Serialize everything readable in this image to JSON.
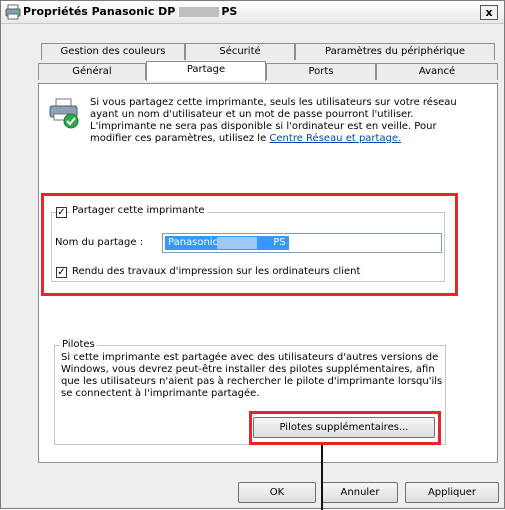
{
  "window": {
    "title_left": "Propriétés Panasonic DP",
    "title_right": "PS",
    "close_label": "x"
  },
  "tabs_row1": [
    {
      "label": "Gestion des couleurs"
    },
    {
      "label": "Sécurité"
    },
    {
      "label": "Paramètres du périphérique"
    }
  ],
  "tabs_row2": [
    {
      "label": "Général"
    },
    {
      "label": "Partage",
      "active": true
    },
    {
      "label": "Ports"
    },
    {
      "label": "Avancé"
    }
  ],
  "info": {
    "text": "Si vous partagez cette imprimante, seuls les utilisateurs sur votre réseau ayant un nom d'utilisateur et un mot de passe pourront l'utiliser. L'imprimante ne sera pas disponible si l'ordinateur est en veille. Pour modifier ces paramètres, utilisez le",
    "link": "Centre Réseau et partage."
  },
  "share": {
    "checkbox_label": "Partager cette imprimante",
    "checked": true,
    "name_label": "Nom du partage :",
    "name_value_left": "Panasonic DP",
    "name_value_right": "PS",
    "render_label": "Rendu des travaux d'impression sur les ordinateurs client",
    "render_checked": true
  },
  "drivers": {
    "legend": "Pilotes",
    "text": "Si cette imprimante est partagée avec des utilisateurs d'autres versions de Windows, vous devrez peut-être installer des pilotes supplémentaires, afin que les utilisateurs n'aient pas à rechercher le pilote d'imprimante lorsqu'ils se connectent à l'imprimante partagée.",
    "button_label": "Pilotes supplémentaires..."
  },
  "footer": {
    "ok_label": "OK",
    "cancel_label": "Annuler",
    "apply_label": "Appliquer"
  },
  "colors": {
    "highlight_red": "#e8252b",
    "selection_blue": "#3399ff",
    "link_blue": "#0645ad"
  }
}
